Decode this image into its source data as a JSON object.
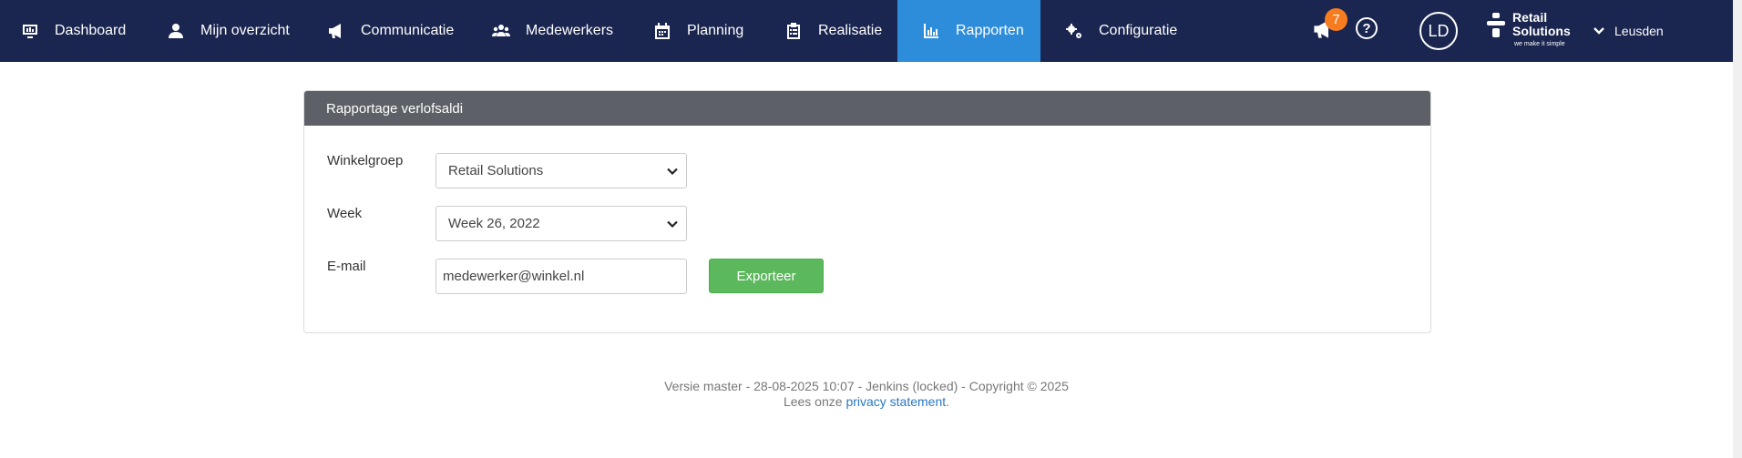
{
  "nav": {
    "items": [
      {
        "label": "Dashboard",
        "icon": "monitor-icon"
      },
      {
        "label": "Mijn overzicht",
        "icon": "person-icon"
      },
      {
        "label": "Communicatie",
        "icon": "megaphone-icon"
      },
      {
        "label": "Medewerkers",
        "icon": "users-icon"
      },
      {
        "label": "Planning",
        "icon": "calendar-icon"
      },
      {
        "label": "Realisatie",
        "icon": "clipboard-icon"
      },
      {
        "label": "Rapporten",
        "icon": "bar-chart-icon",
        "active": true
      },
      {
        "label": "Configuratie",
        "icon": "gears-icon"
      }
    ],
    "notifications_count": "7",
    "help_symbol": "?",
    "avatar_initials": "LD",
    "logo": {
      "line1": "Retail",
      "line2": "Solutions",
      "tagline": "we make it simple"
    },
    "location": "Leusden"
  },
  "colors": {
    "navbar_bg": "#1a2550",
    "nav_active": "#2e8ddb",
    "badge": "#f57c1f",
    "panel_header": "#5d6167",
    "export_button": "#5cb85c",
    "link": "#2a78c4"
  },
  "panel": {
    "title": "Rapportage verlofsaldi",
    "fields": {
      "winkelgroep_label": "Winkelgroep",
      "winkelgroep_value": "Retail Solutions",
      "week_label": "Week",
      "week_value": "Week 26, 2022",
      "email_label": "E-mail",
      "email_value": "medewerker@winkel.nl"
    },
    "export_label": "Exporteer"
  },
  "footer": {
    "version_line": "Versie master - 28-08-2025 10:07 - Jenkins (locked) - Copyright © 2025",
    "privacy_prefix": "Lees onze ",
    "privacy_link": "privacy statement",
    "privacy_suffix": "."
  }
}
